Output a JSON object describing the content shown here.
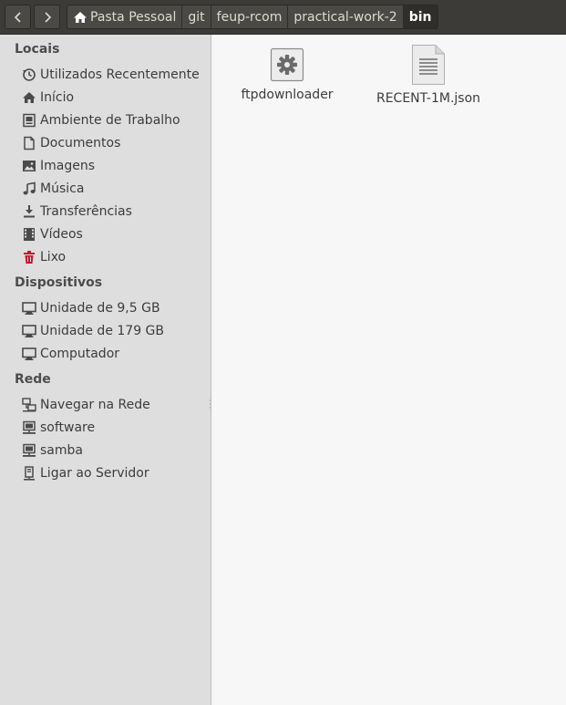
{
  "nav": {
    "back_icon": "chevron-left-icon",
    "forward_icon": "chevron-right-icon"
  },
  "breadcrumbs": [
    {
      "label": "Pasta Pessoal",
      "icon": "home-icon"
    },
    {
      "label": "git"
    },
    {
      "label": "feup-rcom"
    },
    {
      "label": "practical-work-2"
    },
    {
      "label": "bin",
      "active": true
    }
  ],
  "sidebar": {
    "sections": {
      "locais": "Locais",
      "dispositivos": "Dispositivos",
      "rede": "Rede"
    },
    "locais_items": [
      {
        "label": "Utilizados Recentemente",
        "icon": "recent-clock-icon"
      },
      {
        "label": "Início",
        "icon": "home-icon"
      },
      {
        "label": "Ambiente de Trabalho",
        "icon": "desktop-icon"
      },
      {
        "label": "Documentos",
        "icon": "document-icon"
      },
      {
        "label": "Imagens",
        "icon": "picture-icon"
      },
      {
        "label": "Música",
        "icon": "music-note-icon"
      },
      {
        "label": "Transferências",
        "icon": "download-icon"
      },
      {
        "label": "Vídeos",
        "icon": "film-icon"
      },
      {
        "label": "Lixo",
        "icon": "trash-icon"
      }
    ],
    "dispositivos_items": [
      {
        "label": "Unidade de 9,5 GB",
        "icon": "drive-icon"
      },
      {
        "label": "Unidade de 179 GB",
        "icon": "drive-icon"
      },
      {
        "label": "Computador",
        "icon": "computer-icon"
      }
    ],
    "rede_items": [
      {
        "label": "Navegar na Rede",
        "icon": "network-icon"
      },
      {
        "label": "software",
        "icon": "network-share-icon"
      },
      {
        "label": "samba",
        "icon": "network-share-icon"
      },
      {
        "label": "Ligar ao Servidor",
        "icon": "server-icon"
      }
    ]
  },
  "files": [
    {
      "name": "ftpdownloader",
      "icon": "executable-gear-icon"
    },
    {
      "name": "RECENT-1M.json",
      "icon": "text-document-icon"
    }
  ],
  "colors": {
    "toolbar": "#3c3b37",
    "sidebar": "#dedede",
    "trash_red": "#c7162b"
  }
}
